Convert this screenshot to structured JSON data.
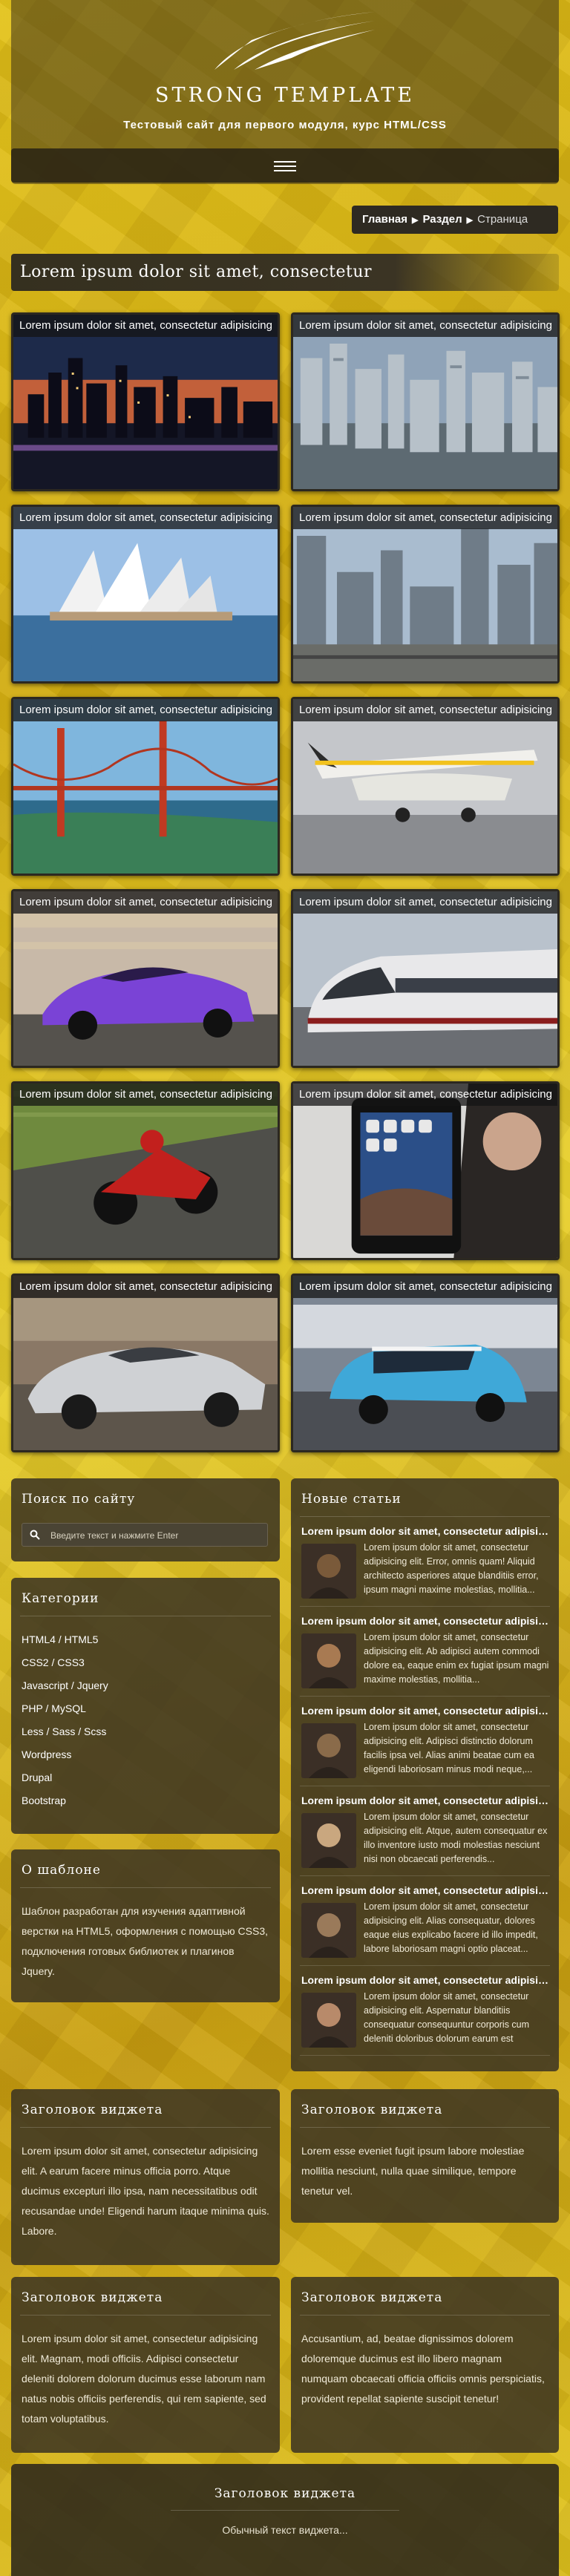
{
  "header": {
    "site_title": "STRONG TEMPLATE",
    "subtitle": "Тестовый сайт для первого модуля, курс HTML/CSS",
    "menu_icon": "hamburger-menu-icon"
  },
  "breadcrumb": {
    "items": [
      "Главная",
      "Раздел"
    ],
    "current": "Страница"
  },
  "page": {
    "heading": "Lorem ipsum dolor sit amet, consectetur"
  },
  "gallery": [
    {
      "caption": "Lorem ipsum dolor sit amet, consectetur adipisicing",
      "scene": "city-night"
    },
    {
      "caption": "Lorem ipsum dolor sit amet, consectetur adipisicing",
      "scene": "city-aerial"
    },
    {
      "caption": "Lorem ipsum dolor sit amet, consectetur adipisicing",
      "scene": "opera-house"
    },
    {
      "caption": "Lorem ipsum dolor sit amet, consectetur adipisicing",
      "scene": "skyscrapers"
    },
    {
      "caption": "Lorem ipsum dolor sit amet, consectetur adipisicing",
      "scene": "golden-gate"
    },
    {
      "caption": "Lorem ipsum dolor sit amet, consectetur adipisicing",
      "scene": "airplane"
    },
    {
      "caption": "Lorem ipsum dolor sit amet, consectetur adipisicing",
      "scene": "sports-car"
    },
    {
      "caption": "Lorem ipsum dolor sit amet, consectetur adipisicing",
      "scene": "train"
    },
    {
      "caption": "Lorem ipsum dolor sit amet, consectetur adipisicing",
      "scene": "motorcycle"
    },
    {
      "caption": "Lorem ipsum dolor sit amet, consectetur adipisicing",
      "scene": "tablet"
    },
    {
      "caption": "Lorem ipsum dolor sit amet, consectetur adipisicing",
      "scene": "silver-car"
    },
    {
      "caption": "Lorem ipsum dolor sit amet, consectetur adipisicing",
      "scene": "mini-car"
    }
  ],
  "search": {
    "title": "Поиск по сайту",
    "placeholder": "Введите текст и нажмите Enter"
  },
  "categories": {
    "title": "Категории",
    "items": [
      "HTML4 / HTML5",
      "CSS2 / CSS3",
      "Javascript / Jquery",
      "PHP / MySQL",
      "Less / Sass / Scss",
      "Wordpress",
      "Drupal",
      "Bootstrap"
    ]
  },
  "about": {
    "title": "О шаблоне",
    "text": "Шаблон разработан для изучения адаптивной верстки на HTML5, оформления с помощью CSS3, подключения готовых библиотек и плагинов Jquery."
  },
  "articles": {
    "title": "Новые статьи",
    "items": [
      {
        "title": "Lorem ipsum dolor sit amet, consectetur adipisicing",
        "excerpt": "Lorem ipsum dolor sit amet, consectetur adipisicing elit. Error, omnis quam! Aliquid architecto asperiores atque blanditiis error, ipsum magni maxime molestias, mollitia..."
      },
      {
        "title": "Lorem ipsum dolor sit amet, consectetur adipisicing",
        "excerpt": "Lorem ipsum dolor sit amet, consectetur adipisicing elit. Ab adipisci autem commodi dolore ea, eaque enim ex fugiat ipsum magni maxime molestias, mollitia..."
      },
      {
        "title": "Lorem ipsum dolor sit amet, consectetur adipisicing",
        "excerpt": "Lorem ipsum dolor sit amet, consectetur adipisicing elit. Adipisci distinctio dolorum facilis ipsa vel. Alias animi beatae cum ea eligendi laboriosam minus modi neque,..."
      },
      {
        "title": "Lorem ipsum dolor sit amet, consectetur adipisicing",
        "excerpt": "Lorem ipsum dolor sit amet, consectetur adipisicing elit. Atque, autem consequatur ex illo inventore iusto modi molestias nesciunt nisi non obcaecati perferendis..."
      },
      {
        "title": "Lorem ipsum dolor sit amet, consectetur adipisicing",
        "excerpt": "Lorem ipsum dolor sit amet, consectetur adipisicing elit. Alias consequatur, dolores eaque eius explicabo facere id illo impedit, labore laboriosam magni optio placeat..."
      },
      {
        "title": "Lorem ipsum dolor sit amet, consectetur adipisicing",
        "excerpt": "Lorem ipsum dolor sit amet, consectetur adipisicing elit. Aspernatur blanditiis consequatur consequuntur corporis cum deleniti doloribus dolorum earum est explicabo..."
      }
    ]
  },
  "widgets": [
    {
      "title": "Заголовок виджета",
      "text": "Lorem ipsum dolor sit amet, consectetur adipisicing elit. A earum facere minus officia porro. Atque ducimus excepturi illo ipsa, nam necessitatibus odit recusandae unde! Eligendi harum itaque minima quis. Labore."
    },
    {
      "title": "Заголовок виджета",
      "text": "Lorem esse eveniet fugit ipsum labore molestiae mollitia nesciunt, nulla quae similique, tempore tenetur vel."
    },
    {
      "title": "Заголовок виджета",
      "text": "Lorem ipsum dolor sit amet, consectetur adipisicing elit. Magnam, modi officiis. Adipisci consectetur deleniti dolorem dolorum ducimus esse laborum nam natus nobis officiis perferendis, qui rem sapiente, sed totam voluptatibus."
    },
    {
      "title": "Заголовок виджета",
      "text": "Accusantium, ad, beatae dignissimos dolorem doloremque ducimus est illo libero magnam numquam obcaecati officia officiis omnis perspiciatis, provident repellat sapiente suscipit tenetur!"
    }
  ],
  "footer": {
    "title": "Заголовок виджета",
    "text": "Обычный текст виджета..."
  }
}
